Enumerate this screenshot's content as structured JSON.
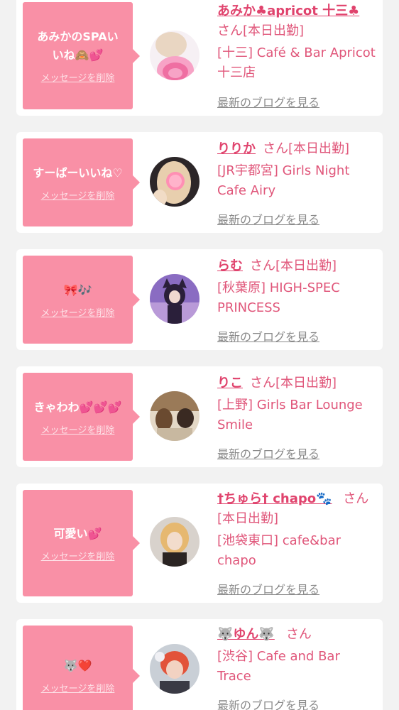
{
  "items": [
    {
      "message": "あみかのSPAいいね🙈💕",
      "delete_label": "メッセージを削除",
      "name": "あみか♣apricot 十三♣",
      "honorific_status": "さん[本日出勤]",
      "shop": "[十三] Café & Bar Apricot 十三店",
      "blog_link": "最新のブログを見る"
    },
    {
      "message": "すーぱーいいね♡",
      "delete_label": "メッセージを削除",
      "name": "りりか",
      "honorific_status": "さん[本日出勤]",
      "shop": "[JR宇都宮] Girls Night Cafe Airy",
      "blog_link": "最新のブログを見る"
    },
    {
      "message": "🎀🎶",
      "delete_label": "メッセージを削除",
      "name": "らむ",
      "honorific_status": "さん[本日出勤]",
      "shop": "[秋葉原] HIGH-SPEC PRINCESS",
      "blog_link": "最新のブログを見る"
    },
    {
      "message": "きゃわわ💕💕💕",
      "delete_label": "メッセージを削除",
      "name": "りこ",
      "honorific_status": "さん[本日出勤]",
      "shop": "[上野] Girls Bar Lounge Smile",
      "blog_link": "最新のブログを見る"
    },
    {
      "message": "可愛い💕",
      "delete_label": "メッセージを削除",
      "name": "†ちゅら† chapo🐾",
      "honorific_status": "さん[本日出勤]",
      "shop": "[池袋東口] cafe&bar chapo",
      "blog_link": "最新のブログを見る"
    },
    {
      "message": "🐺❤️",
      "delete_label": "メッセージを削除",
      "name": "🐺ゆん🐺",
      "honorific_status": "さん",
      "shop": "[渋谷] Cafe and Bar Trace",
      "blog_link": "最新のブログを見る"
    }
  ],
  "colors": {
    "page_background": "#f2f2f2",
    "card_background": "#ffffff",
    "bubble_pink": "#f990a6",
    "accent_text": "#e0567a",
    "link_gray": "#8a8a8a"
  }
}
